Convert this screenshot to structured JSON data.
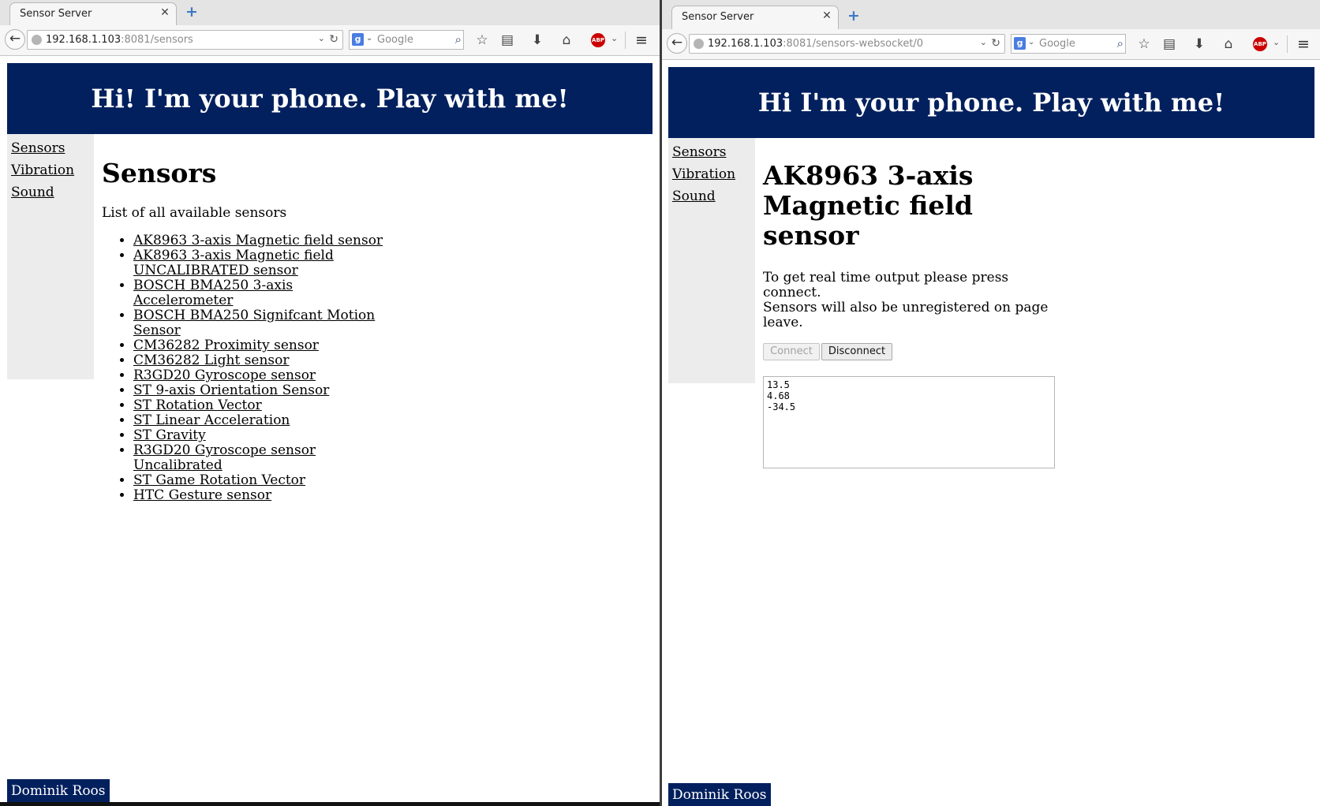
{
  "left_window": {
    "tab": {
      "title": "Sensor Server"
    },
    "url": {
      "host": "192.168.1.103",
      "rest": ":8081/sensors"
    },
    "search": {
      "placeholder": "Google"
    },
    "page": {
      "banner": "Hi! I'm your phone. Play with me!",
      "nav": [
        "Sensors",
        "Vibration",
        "Sound"
      ],
      "heading": "Sensors",
      "intro": "List of all available sensors",
      "sensors": [
        "AK8963 3-axis Magnetic field sensor",
        "AK8963 3-axis Magnetic field UNCALIBRATED sensor",
        "BOSCH BMA250 3-axis Accelerometer",
        "BOSCH BMA250 Signifcant Motion Sensor",
        "CM36282 Proximity sensor",
        "CM36282 Light sensor",
        "R3GD20 Gyroscope sensor",
        "ST 9-axis Orientation Sensor",
        "ST Rotation Vector",
        "ST Linear Acceleration",
        "ST Gravity",
        "R3GD20 Gyroscope sensor Uncalibrated",
        "ST Game Rotation Vector",
        "HTC Gesture sensor"
      ],
      "footer": "Dominik Roos"
    }
  },
  "right_window": {
    "tab": {
      "title": "Sensor Server"
    },
    "url": {
      "host": "192.168.1.103",
      "rest": ":8081/sensors-websocket/0"
    },
    "search": {
      "placeholder": "Google"
    },
    "page": {
      "banner": "Hi I'm your phone. Play with me!",
      "nav": [
        "Sensors",
        "Vibration",
        "Sound"
      ],
      "heading_lines": [
        "AK8963 3-axis",
        "Magnetic field",
        "sensor"
      ],
      "description_lines": [
        "To get real time output please press",
        "connect.",
        "Sensors will also be unregistered on page",
        "leave."
      ],
      "connect_label": "Connect",
      "disconnect_label": "Disconnect",
      "connect_enabled": false,
      "output_values": [
        "13.5",
        "4.68",
        "-34.5"
      ],
      "footer": "Dominik Roos"
    }
  },
  "colors": {
    "banner_bg": "#02205e",
    "sidebar_bg": "#ececec",
    "abp_red": "#cc0000"
  },
  "icons": {
    "back": "arrow-left",
    "close_tab": "close",
    "new_tab": "plus",
    "url_dropdown": "chevron-down",
    "reload": "reload",
    "search": "magnifier",
    "bookmark": "star",
    "reading_list": "clipboard",
    "downloads": "arrow-down",
    "home": "home",
    "adblock": "abp",
    "menu": "hamburger"
  }
}
